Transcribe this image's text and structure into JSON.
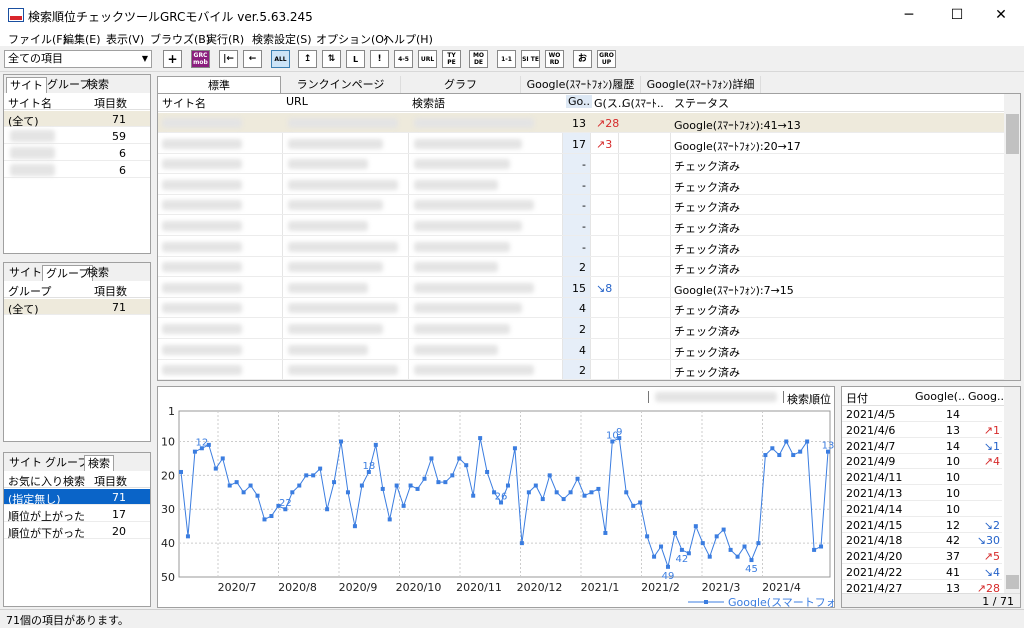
{
  "window": {
    "title": "検索順位チェックツールGRCモバイル  ver.5.63.245",
    "minimize": "─",
    "maximize": "☐",
    "close": "✕"
  },
  "menu": [
    "ファイル(F)",
    "編集(E)",
    "表示(V)",
    "ブラウズ(B)",
    "実行(R)",
    "検索設定(S)",
    "オプション(O)",
    "ヘルプ(H)"
  ],
  "toolbar": {
    "filter_value": "全ての項目",
    "buttons": [
      "+",
      "GRC mob",
      "|←",
      "←",
      "ALL",
      "↥",
      "⇅",
      "L",
      "!",
      "4-5",
      "URL",
      "TY PE",
      "MO DE",
      "1-1",
      "SI TE",
      "WO RD",
      "お",
      "GRO UP"
    ]
  },
  "left": {
    "panel1": {
      "tabs": [
        "サイト",
        "グループ",
        "検索"
      ],
      "headers": [
        "サイト名",
        "項目数"
      ],
      "rows": [
        {
          "name": "(全て)",
          "count": "71"
        },
        {
          "name": "",
          "count": "59"
        },
        {
          "name": "",
          "count": "6"
        },
        {
          "name": "",
          "count": "6"
        }
      ]
    },
    "panel2": {
      "tabs": [
        "サイト",
        "グループ",
        "検索"
      ],
      "headers": [
        "グループ",
        "項目数"
      ],
      "rows": [
        {
          "name": "(全て)",
          "count": "71"
        }
      ]
    },
    "panel3": {
      "tabs": [
        "サイト",
        "グループ",
        "検索"
      ],
      "headers": [
        "お気に入り検索",
        "項目数"
      ],
      "rows": [
        {
          "name": "(指定無し)",
          "count": "71"
        },
        {
          "name": "順位が上がった",
          "count": "17"
        },
        {
          "name": "順位が下がった",
          "count": "20"
        }
      ]
    }
  },
  "main": {
    "tabs": [
      "標準",
      "ランクインページ",
      "グラフ",
      "Google(ｽﾏｰﾄﾌｫﾝ)履歴",
      "Google(ｽﾏｰﾄﾌｫﾝ)詳細"
    ],
    "headers": [
      "サイト名",
      "URL",
      "検索語",
      "Go..",
      "G(ス..",
      "G(ｽﾏｰﾄ..",
      "ステータス"
    ],
    "rows": [
      {
        "rank": "13",
        "change": "↗28",
        "status": "Google(ｽﾏｰﾄﾌｫﾝ):41→13"
      },
      {
        "rank": "17",
        "change": "↗3",
        "status": "Google(ｽﾏｰﾄﾌｫﾝ):20→17"
      },
      {
        "rank": "-",
        "change": "",
        "status": "チェック済み"
      },
      {
        "rank": "-",
        "change": "",
        "status": "チェック済み"
      },
      {
        "rank": "-",
        "change": "",
        "status": "チェック済み"
      },
      {
        "rank": "-",
        "change": "",
        "status": "チェック済み"
      },
      {
        "rank": "-",
        "change": "",
        "status": "チェック済み"
      },
      {
        "rank": "2",
        "change": "",
        "status": "チェック済み"
      },
      {
        "rank": "15",
        "change": "↘8",
        "status": "Google(ｽﾏｰﾄﾌｫﾝ):7→15"
      },
      {
        "rank": "4",
        "change": "",
        "status": "チェック済み"
      },
      {
        "rank": "2",
        "change": "",
        "status": "チェック済み"
      },
      {
        "rank": "4",
        "change": "",
        "status": "チェック済み"
      },
      {
        "rank": "2",
        "change": "",
        "status": "チェック済み"
      }
    ]
  },
  "history": {
    "headers": [
      "日付",
      "Google(..",
      "Goog.."
    ],
    "rows": [
      {
        "date": "2021/4/5",
        "rank": "14",
        "change": ""
      },
      {
        "date": "2021/4/6",
        "rank": "13",
        "change": "↗1"
      },
      {
        "date": "2021/4/7",
        "rank": "14",
        "change": "↘1"
      },
      {
        "date": "2021/4/9",
        "rank": "10",
        "change": "↗4"
      },
      {
        "date": "2021/4/11",
        "rank": "10",
        "change": ""
      },
      {
        "date": "2021/4/13",
        "rank": "10",
        "change": ""
      },
      {
        "date": "2021/4/14",
        "rank": "10",
        "change": ""
      },
      {
        "date": "2021/4/15",
        "rank": "12",
        "change": "↘2"
      },
      {
        "date": "2021/4/18",
        "rank": "42",
        "change": "↘30"
      },
      {
        "date": "2021/4/20",
        "rank": "37",
        "change": "↗5"
      },
      {
        "date": "2021/4/22",
        "rank": "41",
        "change": "↘4"
      },
      {
        "date": "2021/4/27",
        "rank": "13",
        "change": "↗28"
      }
    ],
    "pager": "1 / 71"
  },
  "status_text": "71個の項目があります。",
  "colors": {
    "up": "#d62b2b",
    "down": "#2563c9",
    "line": "#3b7de0",
    "select": "#0a64c8",
    "highlight": "#eeeadc"
  },
  "chart_data": {
    "type": "line",
    "title_suffix": "検索順位",
    "ylim": [
      1,
      50
    ],
    "y_inverted": true,
    "yticks": [
      "1",
      "10",
      "20",
      "30",
      "40",
      "50"
    ],
    "xticks": [
      "2020/7",
      "2020/8",
      "2020/9",
      "2020/10",
      "2020/11",
      "2020/12",
      "2021/1",
      "2021/2",
      "2021/3",
      "2021/4"
    ],
    "series": [
      {
        "name": "Google(スマートフォン)",
        "values": [
          19,
          38,
          13,
          12,
          11,
          18,
          15,
          23,
          22,
          25,
          23,
          26,
          33,
          32,
          29,
          30,
          25,
          23,
          20,
          20,
          18,
          30,
          22,
          10,
          25,
          35,
          23,
          19,
          11,
          24,
          33,
          23,
          29,
          23,
          24,
          21,
          15,
          22,
          22,
          20,
          15,
          17,
          26,
          9,
          19,
          25,
          28,
          23,
          12,
          40,
          25,
          23,
          27,
          20,
          25,
          27,
          25,
          21,
          26,
          25,
          24,
          37,
          10,
          9,
          25,
          29,
          28,
          38,
          44,
          41,
          47,
          37,
          42,
          43,
          35,
          40,
          44,
          38,
          36,
          42,
          44,
          41,
          45,
          40,
          14,
          12,
          14,
          10,
          14,
          13,
          10,
          42,
          41,
          13
        ],
        "labels": [
          {
            "i": 3,
            "text": "12"
          },
          {
            "i": 15,
            "text": "22"
          },
          {
            "i": 27,
            "text": "18"
          },
          {
            "i": 46,
            "text": "26"
          },
          {
            "i": 62,
            "text": "10"
          },
          {
            "i": 63,
            "text": "9"
          },
          {
            "i": 70,
            "text": "49"
          },
          {
            "i": 72,
            "text": "42"
          },
          {
            "i": 82,
            "text": "45"
          },
          {
            "i": 93,
            "text": "13"
          }
        ]
      }
    ]
  }
}
